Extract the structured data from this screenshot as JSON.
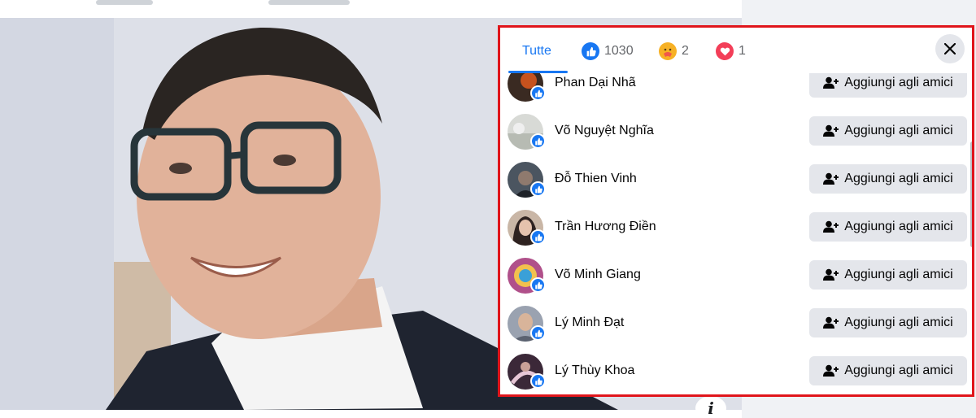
{
  "dialog": {
    "tabs": [
      {
        "label": "Tutte",
        "icon": ""
      },
      {
        "label": "1030",
        "icon": "like-reaction-icon"
      },
      {
        "label": "2",
        "icon": "care-reaction-icon"
      },
      {
        "label": "1",
        "icon": "love-reaction-icon"
      }
    ],
    "close_icon": "close-icon"
  },
  "people": [
    {
      "name": "Phan Dại Nhã",
      "button": "Aggiungi agli amici",
      "avatar_color": "#3a2a22"
    },
    {
      "name": "Võ Nguyệt Nghĩa",
      "button": "Aggiungi agli amici",
      "avatar_color": "#c9ccc8"
    },
    {
      "name": "Đỗ Thien Vinh",
      "button": "Aggiungi agli amici",
      "avatar_color": "#4b5560"
    },
    {
      "name": "Trần Hương Điền",
      "button": "Aggiungi agli amici",
      "avatar_color": "#8a7060"
    },
    {
      "name": "Võ Minh Giang",
      "button": "Aggiungi agli amici",
      "avatar_color": "#b0508a"
    },
    {
      "name": "Lý Minh Đạt",
      "button": "Aggiungi agli amici",
      "avatar_color": "#9aa2b0"
    },
    {
      "name": "Lý Thùy Khoa",
      "button": "Aggiungi agli amici",
      "avatar_color": "#3b2838"
    }
  ],
  "photo_info_label": "i",
  "colors": {
    "accent": "#1877f2",
    "highlight_border": "#e0151b",
    "button_bg": "#e4e6eb"
  }
}
